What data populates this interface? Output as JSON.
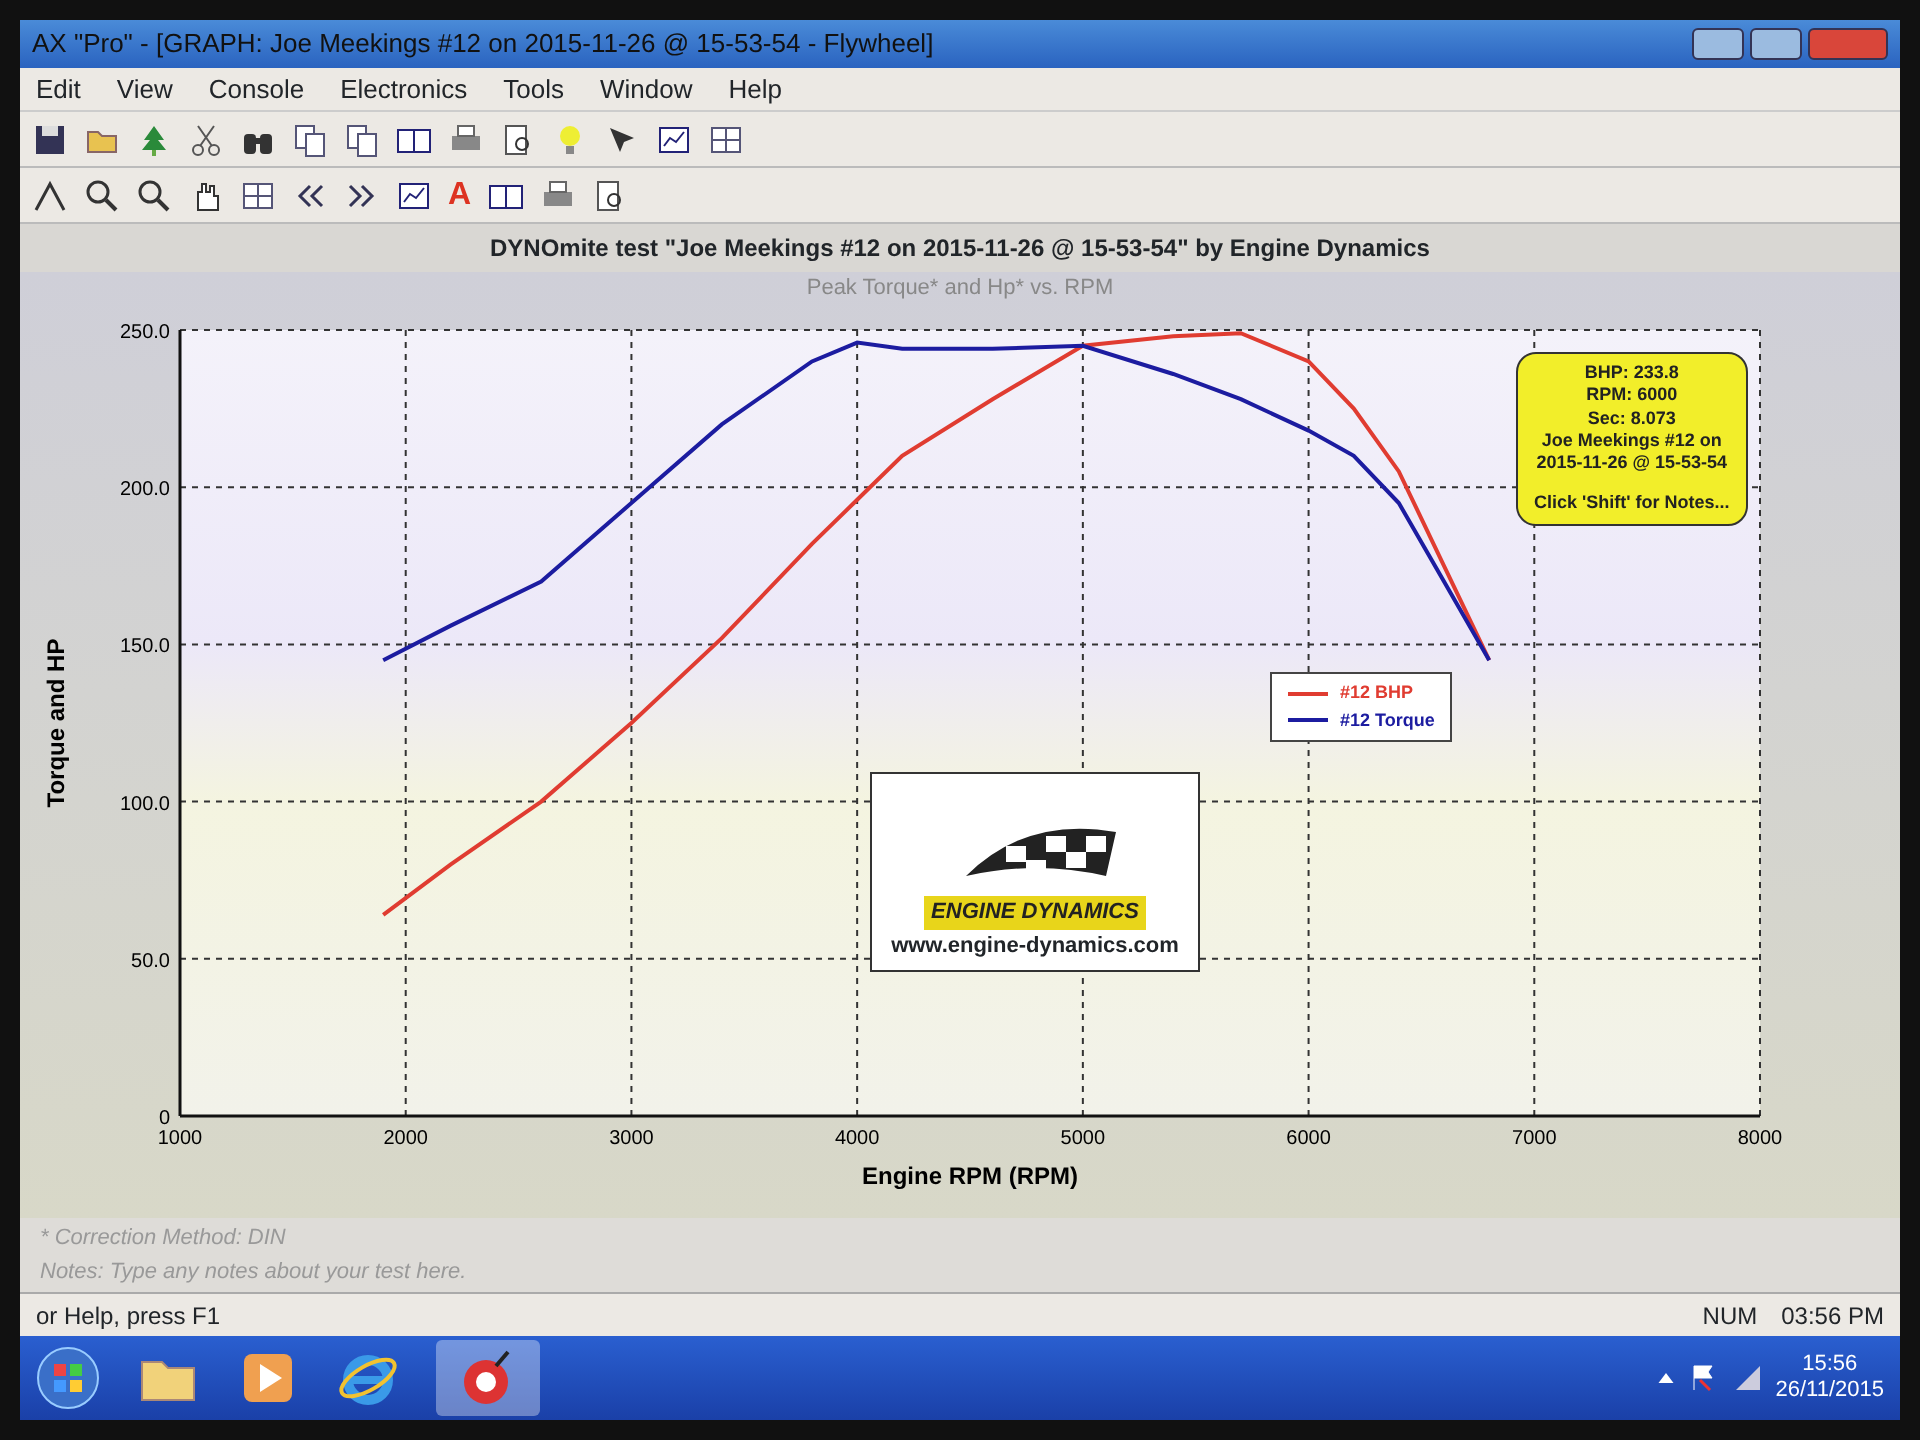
{
  "window": {
    "title": "AX \"Pro\" - [GRAPH: Joe Meekings #12 on 2015-11-26 @ 15-53-54 - Flywheel]"
  },
  "menu": [
    "Edit",
    "View",
    "Console",
    "Electronics",
    "Tools",
    "Window",
    "Help"
  ],
  "toolbar": {
    "font_button_label": "A"
  },
  "chart_heading": "DYNOmite test \"Joe Meekings #12 on 2015-11-26 @ 15-53-54\" by Engine Dynamics",
  "chart": {
    "chart_data": {
      "type": "line",
      "title": "Peak Torque* and Hp* vs. RPM",
      "xlabel": "Engine RPM (RPM)",
      "ylabel": "Torque and HP",
      "x": [
        1900,
        2200,
        2600,
        3000,
        3400,
        3800,
        4000,
        4200,
        4600,
        5000,
        5400,
        5700,
        6000,
        6200,
        6400,
        6600,
        6800
      ],
      "series": [
        {
          "name": "#12 BHP",
          "color": "#e03c31",
          "values": [
            64,
            80,
            100,
            125,
            152,
            182,
            196,
            210,
            228,
            245,
            248,
            249,
            240,
            225,
            205,
            175,
            145
          ]
        },
        {
          "name": "#12 Torque",
          "color": "#1c1ca0",
          "values": [
            145,
            156,
            170,
            195,
            220,
            240,
            246,
            244,
            244,
            245,
            236,
            228,
            218,
            210,
            195,
            170,
            145
          ]
        }
      ],
      "grid": true,
      "xlim": [
        1000,
        8000
      ],
      "ylim": [
        0,
        250
      ],
      "xticks": [
        1000,
        2000,
        3000,
        4000,
        5000,
        6000,
        7000,
        8000
      ],
      "yticks": [
        {
          "value": 0,
          "label": "0"
        },
        {
          "value": 50,
          "label": "50.0"
        },
        {
          "value": 100,
          "label": "100.0"
        },
        {
          "value": 150,
          "label": "150.0"
        },
        {
          "value": 200,
          "label": "200.0"
        },
        {
          "value": 250,
          "label": "250.0"
        }
      ]
    },
    "callout": [
      "BHP: 233.8",
      "RPM: 6000",
      "Sec: 8.073",
      "Joe Meekings #12 on",
      "2015-11-26 @ 15-53-54",
      "Click 'Shift' for Notes..."
    ],
    "logo": {
      "name": "ENGINE DYNAMICS",
      "url": "www.engine-dynamics.com"
    }
  },
  "notes": [
    "* Correction Method: DIN",
    "Notes: Type any notes about your test here."
  ],
  "status_bar": {
    "help": "or Help, press F1",
    "num": "NUM",
    "time": "03:56 PM"
  },
  "taskbar": {
    "time": "15:56",
    "date": "26/11/2015"
  }
}
